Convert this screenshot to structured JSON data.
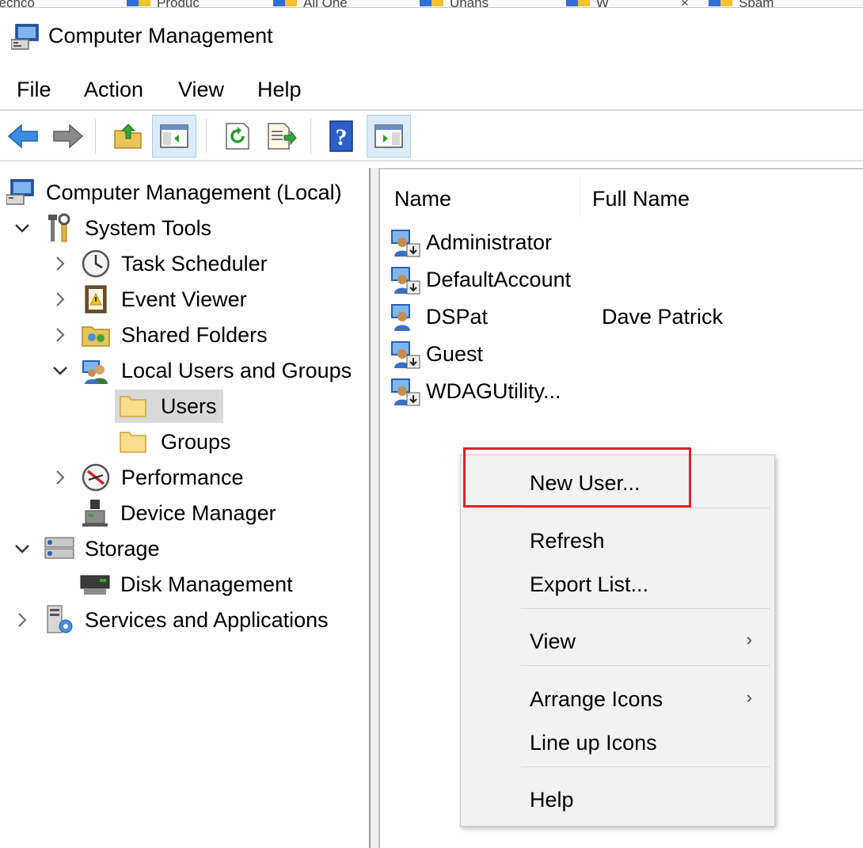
{
  "taskbar": {
    "items": [
      "Tecnco",
      "Produc",
      "All One",
      "Unans",
      "W",
      "×",
      "Spam"
    ]
  },
  "window": {
    "title": "Computer Management"
  },
  "menu": {
    "items": [
      "File",
      "Action",
      "View",
      "Help"
    ]
  },
  "toolbar": {
    "buttons": [
      "back-arrow-icon",
      "forward-arrow-icon",
      "up-folder-icon",
      "show-hide-console-tree-icon",
      "refresh-icon",
      "export-list-icon",
      "help-icon",
      "show-hide-action-pane-icon"
    ]
  },
  "tree": {
    "root": "Computer Management (Local)",
    "system_tools": "System Tools",
    "task_scheduler": "Task Scheduler",
    "event_viewer": "Event Viewer",
    "shared_folders": "Shared Folders",
    "local_users_groups": "Local Users and Groups",
    "users": "Users",
    "groups": "Groups",
    "performance": "Performance",
    "device_manager": "Device Manager",
    "storage": "Storage",
    "disk_management": "Disk Management",
    "services_apps": "Services and Applications"
  },
  "list": {
    "columns": [
      "Name",
      "Full Name"
    ],
    "rows": [
      {
        "name": "Administrator",
        "full_name": ""
      },
      {
        "name": "DefaultAccount",
        "full_name": ""
      },
      {
        "name": "DSPat",
        "full_name": "Dave Patrick"
      },
      {
        "name": "Guest",
        "full_name": ""
      },
      {
        "name": "WDAGUtility...",
        "full_name": ""
      }
    ]
  },
  "context_menu": {
    "new_user": "New User...",
    "refresh": "Refresh",
    "export_list": "Export List...",
    "view": "View",
    "arrange_icons": "Arrange Icons",
    "line_up_icons": "Line up Icons",
    "help": "Help",
    "submenu_arrow": "›",
    "highlight_color": "#e0202c"
  }
}
